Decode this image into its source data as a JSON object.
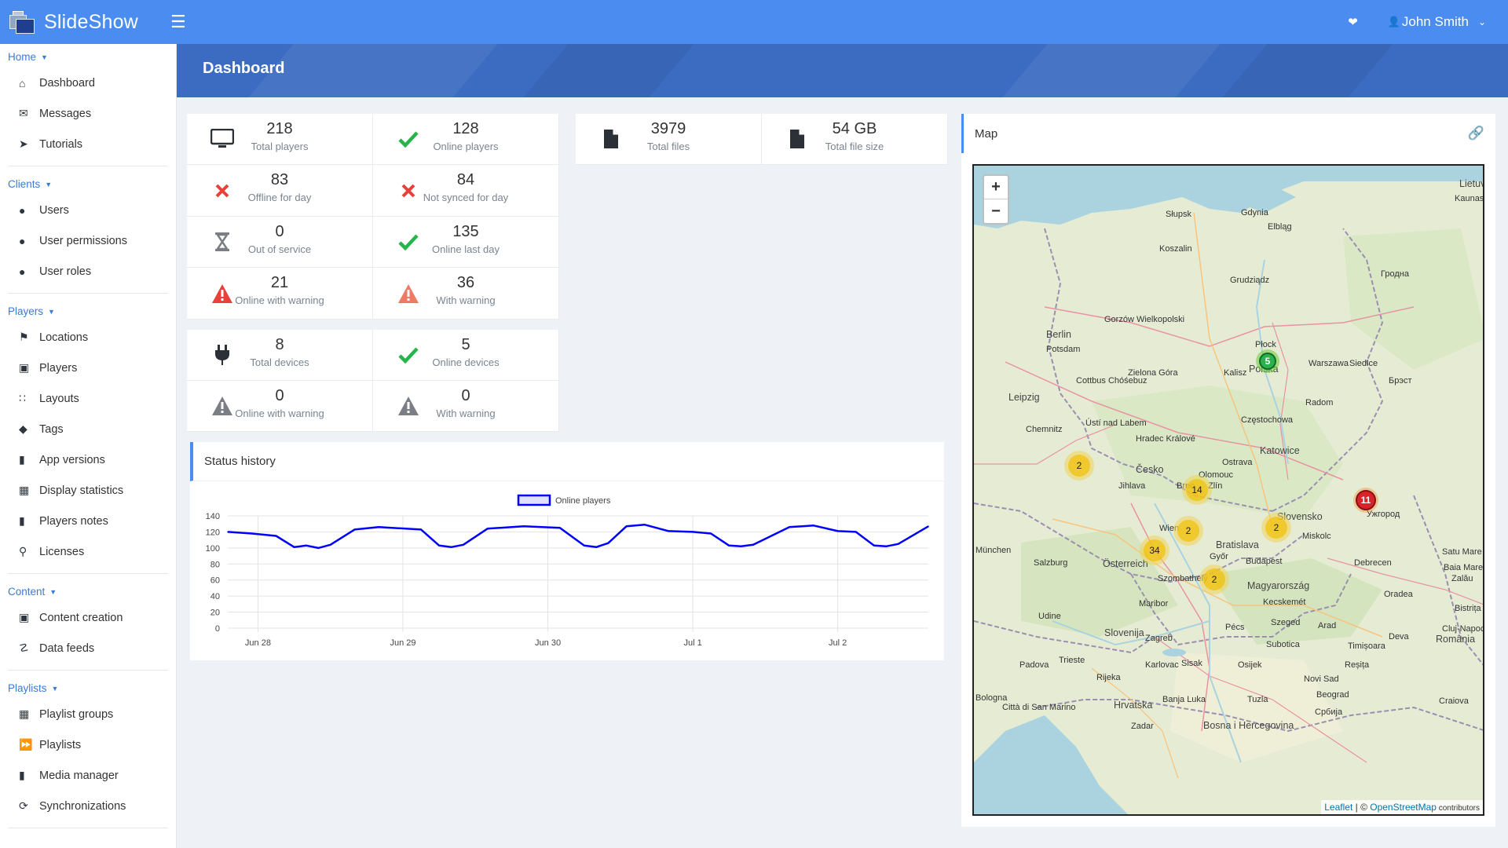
{
  "app": {
    "name": "SlideShow"
  },
  "topbar": {
    "user_name": "John Smith"
  },
  "sidebar": {
    "sections": [
      {
        "title": "Home",
        "items": [
          {
            "label": "Dashboard",
            "icon": "home-icon"
          },
          {
            "label": "Messages",
            "icon": "envelope-icon"
          },
          {
            "label": "Tutorials",
            "icon": "rocket-icon"
          }
        ]
      },
      {
        "title": "Clients",
        "items": [
          {
            "label": "Users",
            "icon": "user-icon"
          },
          {
            "label": "User permissions",
            "icon": "user-lock-icon"
          },
          {
            "label": "User roles",
            "icon": "user-tag-icon"
          }
        ]
      },
      {
        "title": "Players",
        "items": [
          {
            "label": "Locations",
            "icon": "map-marked-icon"
          },
          {
            "label": "Players",
            "icon": "desktop-icon"
          },
          {
            "label": "Layouts",
            "icon": "grid-icon"
          },
          {
            "label": "Tags",
            "icon": "tag-icon"
          },
          {
            "label": "App versions",
            "icon": "mobile-icon"
          },
          {
            "label": "Display statistics",
            "icon": "calculator-icon"
          },
          {
            "label": "Players notes",
            "icon": "clipboard-icon"
          },
          {
            "label": "Licenses",
            "icon": "key-icon"
          }
        ]
      },
      {
        "title": "Content",
        "items": [
          {
            "label": "Content creation",
            "icon": "file-edit-icon"
          },
          {
            "label": "Data feeds",
            "icon": "rss-icon"
          }
        ]
      },
      {
        "title": "Playlists",
        "items": [
          {
            "label": "Playlist groups",
            "icon": "object-group-icon"
          },
          {
            "label": "Playlists",
            "icon": "play-forward-icon"
          },
          {
            "label": "Media manager",
            "icon": "file-icon"
          },
          {
            "label": "Synchronizations",
            "icon": "sync-icon"
          }
        ]
      }
    ]
  },
  "page": {
    "title": "Dashboard"
  },
  "players_stats": [
    {
      "value": "218",
      "label": "Total players",
      "icon": "desktop-icon",
      "color": "#2c3138"
    },
    {
      "value": "128",
      "label": "Online players",
      "icon": "check-icon",
      "color": "#28b44a"
    },
    {
      "value": "83",
      "label": "Offline for day",
      "icon": "times-icon",
      "color": "#e8403a"
    },
    {
      "value": "84",
      "label": "Not synced for day",
      "icon": "times-icon",
      "color": "#e8403a"
    },
    {
      "value": "0",
      "label": "Out of service",
      "icon": "hourglass-icon",
      "color": "#7b7f85"
    },
    {
      "value": "135",
      "label": "Online last day",
      "icon": "check-icon",
      "color": "#28b44a"
    },
    {
      "value": "21",
      "label": "Online with warning",
      "icon": "warning-icon",
      "color": "#e8403a"
    },
    {
      "value": "36",
      "label": "With warning",
      "icon": "warning-icon",
      "color": "#ef7a63"
    }
  ],
  "device_stats": [
    {
      "value": "8",
      "label": "Total devices",
      "icon": "plug-icon",
      "color": "#2c3138"
    },
    {
      "value": "5",
      "label": "Online devices",
      "icon": "check-icon",
      "color": "#28b44a"
    },
    {
      "value": "0",
      "label": "Online with warning",
      "icon": "warning-icon",
      "color": "#7b7f85"
    },
    {
      "value": "0",
      "label": "With warning",
      "icon": "warning-icon",
      "color": "#7b7f85"
    }
  ],
  "file_stats": [
    {
      "value": "3979",
      "label": "Total files",
      "icon": "file-icon",
      "color": "#2c3138"
    },
    {
      "value": "54 GB",
      "label": "Total file size",
      "icon": "file-icon",
      "color": "#2c3138"
    }
  ],
  "status_history": {
    "title": "Status history"
  },
  "chart_data": {
    "type": "line",
    "title": "",
    "xlabel": "",
    "ylabel": "",
    "legend": "top-center",
    "grid": true,
    "ylim": [
      0,
      140
    ],
    "yticks": [
      0,
      20,
      40,
      60,
      80,
      100,
      120,
      140
    ],
    "xlim": [
      "2023-06-27 19:00",
      "2023-07-02 15:00"
    ],
    "xticks": [
      "Jun 28",
      "Jun 29",
      "Jun 30",
      "Jul 1",
      "Jul 2"
    ],
    "series": [
      {
        "name": "Online players",
        "color": "#0000ff",
        "x": [
          "2023-06-27 19:00",
          "2023-06-27 23:00",
          "2023-06-28 03:00",
          "2023-06-28 06:00",
          "2023-06-28 08:00",
          "2023-06-28 10:00",
          "2023-06-28 12:00",
          "2023-06-28 16:00",
          "2023-06-28 20:00",
          "2023-06-29 03:00",
          "2023-06-29 06:00",
          "2023-06-29 08:00",
          "2023-06-29 10:00",
          "2023-06-29 14:00",
          "2023-06-29 20:00",
          "2023-06-30 02:00",
          "2023-06-30 06:00",
          "2023-06-30 08:00",
          "2023-06-30 10:00",
          "2023-06-30 13:00",
          "2023-06-30 16:00",
          "2023-06-30 20:00",
          "2023-07-01 00:00",
          "2023-07-01 03:00",
          "2023-07-01 06:00",
          "2023-07-01 08:00",
          "2023-07-01 10:00",
          "2023-07-01 16:00",
          "2023-07-01 20:00",
          "2023-07-02 00:00",
          "2023-07-02 03:00",
          "2023-07-02 06:00",
          "2023-07-02 08:00",
          "2023-07-02 10:00",
          "2023-07-02 15:00"
        ],
        "values": [
          120,
          118,
          115,
          101,
          103,
          100,
          104,
          123,
          126,
          123,
          103,
          101,
          104,
          124,
          127,
          125,
          103,
          101,
          106,
          127,
          129,
          121,
          120,
          118,
          103,
          102,
          104,
          126,
          128,
          121,
          120,
          103,
          102,
          105,
          127
        ]
      }
    ]
  },
  "map": {
    "title": "Map",
    "zoom_in": "+",
    "zoom_out": "−",
    "attribution_leaflet": "Leaflet",
    "attribution_sep": " | © ",
    "attribution_osm": "OpenStreetMap",
    "attribution_suffix": " contributors",
    "clusters": [
      {
        "count": "5",
        "status": "green"
      },
      {
        "count": "11",
        "status": "red"
      },
      {
        "count": "14",
        "status": "yellow"
      },
      {
        "count": "2",
        "status": "yellow"
      },
      {
        "count": "2",
        "status": "yellow"
      },
      {
        "count": "2",
        "status": "yellow"
      },
      {
        "count": "34",
        "status": "yellow"
      },
      {
        "count": "2",
        "status": "yellow"
      }
    ],
    "labels": [
      "Lietuva",
      "Kaunas",
      "Gdynia",
      "Słupsk",
      "Elbląg",
      "Koszalin",
      "Grudziądz",
      "Berlin",
      "Potsdam",
      "Gorzów Wielkopolski",
      "Płock",
      "Warszawa",
      "Siedlce",
      "Брэст",
      "Гродна",
      "Polska",
      "Kalisz",
      "Zielona Góra",
      "Cottbus Chóśebuz",
      "Leipzig",
      "Radom",
      "Chemnitz",
      "Ústí nad Labem",
      "Hradec Králové",
      "Częstochowa",
      "Katowice",
      "Ostrava",
      "Olomouc",
      "Česko",
      "Brno",
      "Jihlava",
      "Zlín",
      "Slovensko",
      "Wien",
      "Bratislava",
      "Győr",
      "Budapest",
      "Miskolc",
      "Ужгород",
      "München",
      "Salzburg",
      "Österreich",
      "Szombathely",
      "Magyarország",
      "Debrecen",
      "Satu Mare",
      "Baia Mare",
      "Zalău",
      "Oradea",
      "Kecskemét",
      "Bistrița",
      "Cluj-Napoca",
      "Maribor",
      "Udine",
      "Slovenija",
      "Zagreb",
      "Pécs",
      "Szeged",
      "Arad",
      "Deva",
      "Timișoara",
      "România",
      "Trieste",
      "Rijeka",
      "Karlovac",
      "Sisak",
      "Osijek",
      "Beograd",
      "Reșița",
      "Craiova",
      "Padova",
      "Bologna",
      "Hrvatska",
      "Banja Luka",
      "Tuzla",
      "Србија",
      "Città di San Marino",
      "Zadar",
      "Bosna i Hercegovina",
      "Subotica",
      "Novi Sad"
    ]
  }
}
